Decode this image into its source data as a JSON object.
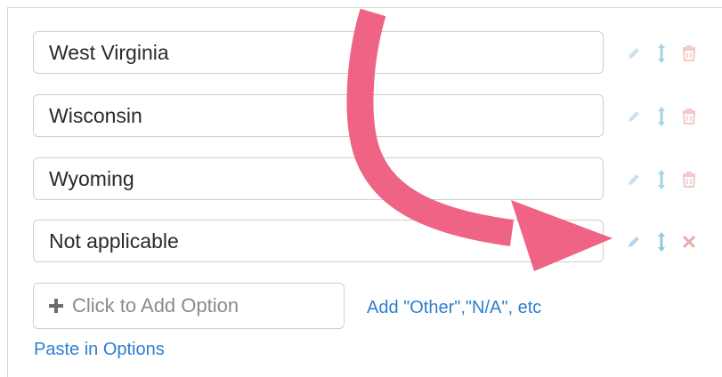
{
  "options": [
    {
      "label": "West Virginia",
      "delete_icon": "trash-icon"
    },
    {
      "label": "Wisconsin",
      "delete_icon": "trash-icon"
    },
    {
      "label": "Wyoming",
      "delete_icon": "trash-icon"
    },
    {
      "label": "Not applicable",
      "delete_icon": "x-icon"
    }
  ],
  "add_option": {
    "label": "Click to Add Option",
    "icon": "plus-icon"
  },
  "links": {
    "add_other": "Add \"Other\",\"N/A\", etc",
    "paste": "Paste in Options"
  },
  "colors": {
    "edit_icon": "#c9dff0",
    "move_icon": "#a6d2e4",
    "trash_icon": "#f2c9c9",
    "x_icon": "#e8a9a9",
    "link": "#2b7fd0",
    "annotation_arrow": "#ef6384"
  }
}
